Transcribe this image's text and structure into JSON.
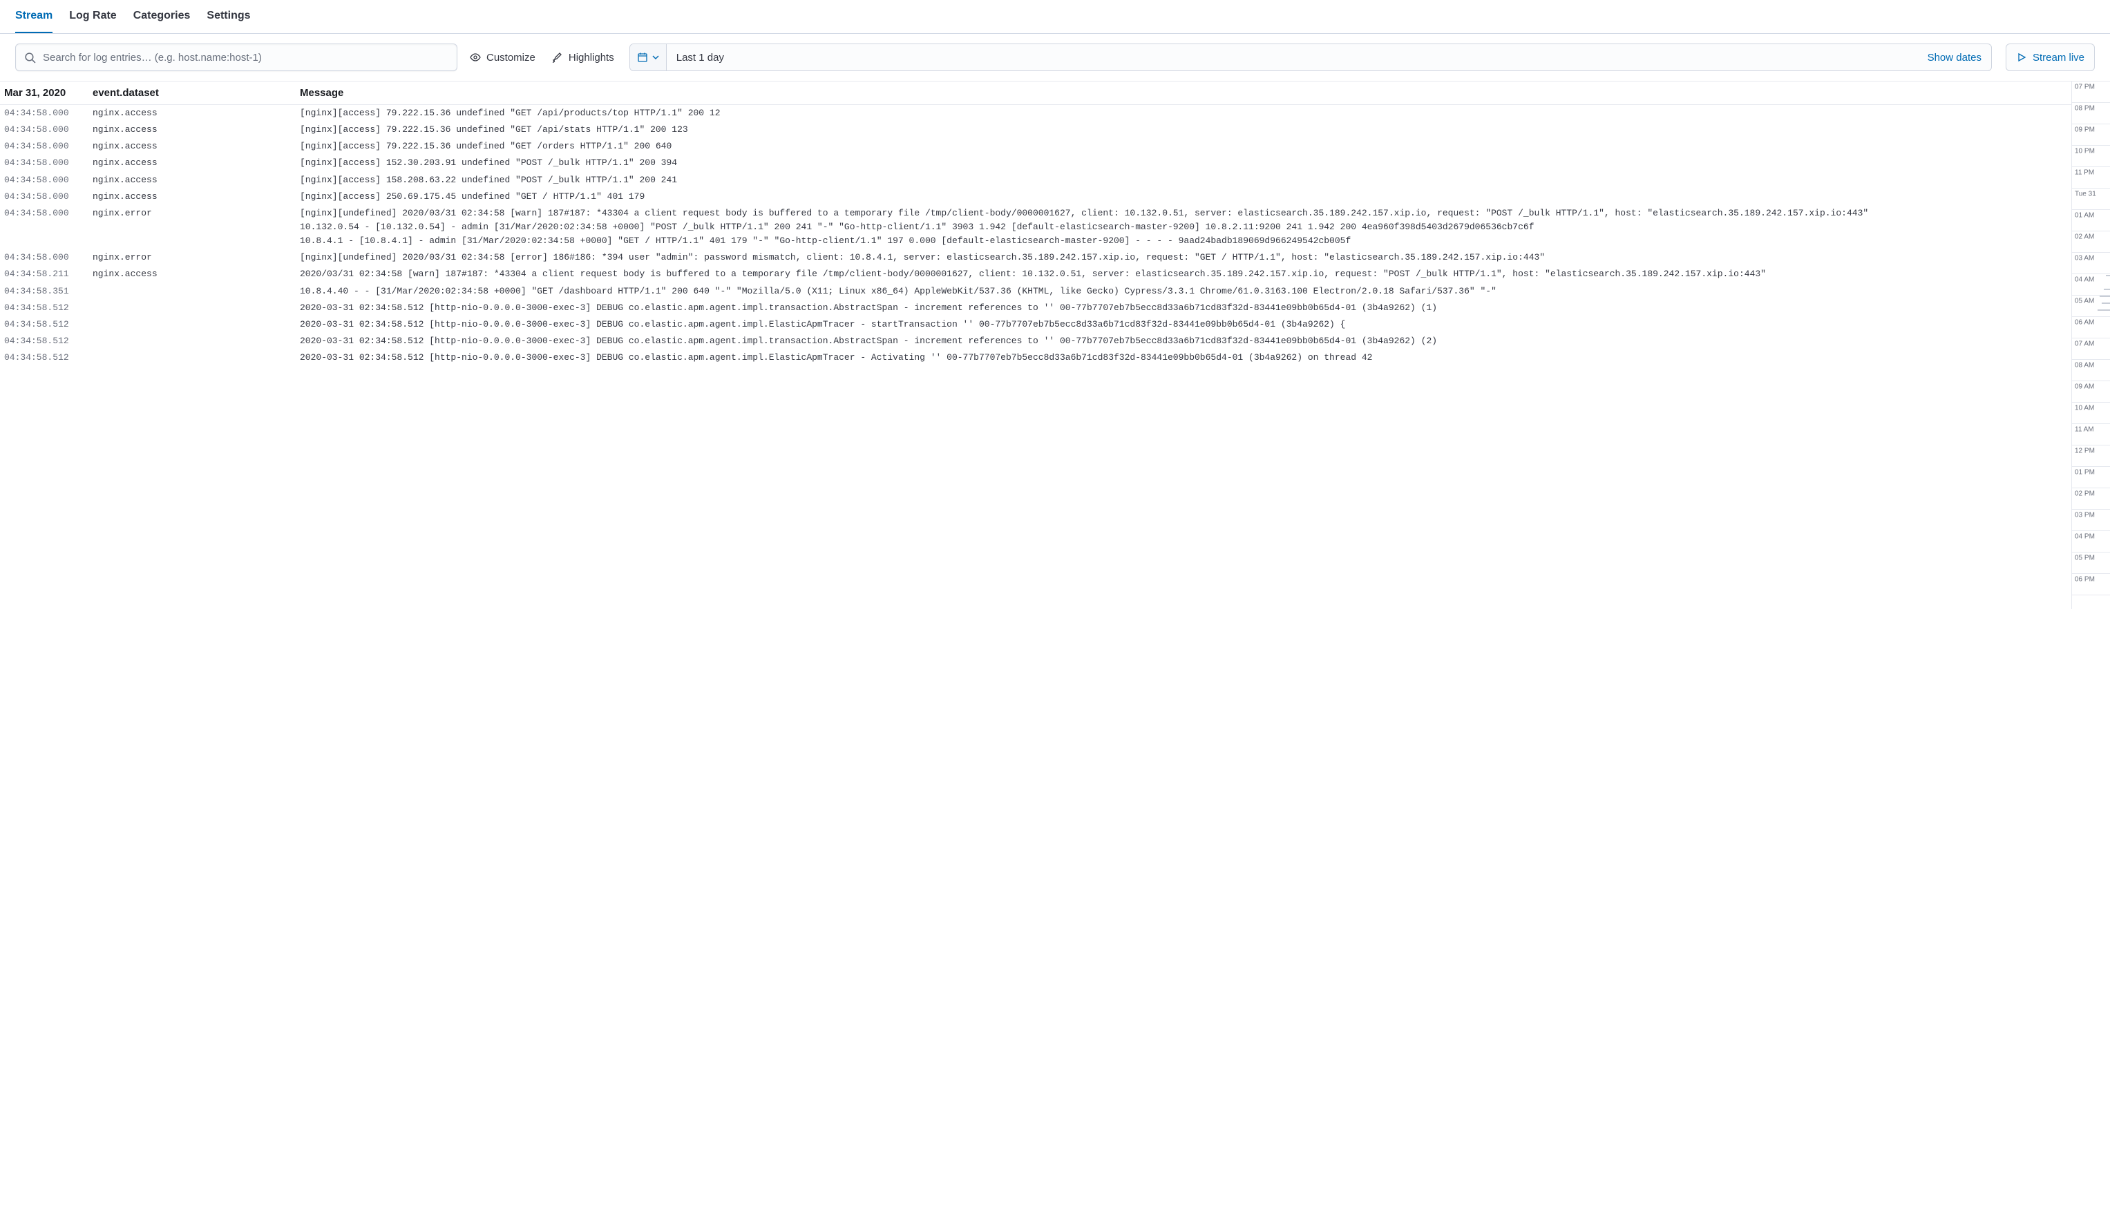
{
  "tabs": [
    {
      "label": "Stream",
      "active": true
    },
    {
      "label": "Log Rate",
      "active": false
    },
    {
      "label": "Categories",
      "active": false
    },
    {
      "label": "Settings",
      "active": false
    }
  ],
  "toolbar": {
    "search_placeholder": "Search for log entries… (e.g. host.name:host-1)",
    "customize_label": "Customize",
    "highlights_label": "Highlights",
    "date_range_text": "Last 1 day",
    "show_dates_label": "Show dates",
    "stream_live_label": "Stream live"
  },
  "columns": {
    "time_header": "Mar 31, 2020",
    "dataset_header": "event.dataset",
    "message_header": "Message"
  },
  "log_rows": [
    {
      "time": "04:34:58.000",
      "dataset": "nginx.access",
      "message": "[nginx][access] 79.222.15.36 undefined \"GET /api/products/top HTTP/1.1\" 200 12"
    },
    {
      "time": "04:34:58.000",
      "dataset": "nginx.access",
      "message": "[nginx][access] 79.222.15.36 undefined \"GET /api/stats HTTP/1.1\" 200 123"
    },
    {
      "time": "04:34:58.000",
      "dataset": "nginx.access",
      "message": "[nginx][access] 79.222.15.36 undefined \"GET /orders HTTP/1.1\" 200 640"
    },
    {
      "time": "04:34:58.000",
      "dataset": "nginx.access",
      "message": "[nginx][access] 152.30.203.91 undefined \"POST /_bulk HTTP/1.1\" 200 394"
    },
    {
      "time": "04:34:58.000",
      "dataset": "nginx.access",
      "message": "[nginx][access] 158.208.63.22 undefined \"POST /_bulk HTTP/1.1\" 200 241"
    },
    {
      "time": "04:34:58.000",
      "dataset": "nginx.access",
      "message": "[nginx][access] 250.69.175.45 undefined \"GET / HTTP/1.1\" 401 179"
    },
    {
      "time": "04:34:58.000",
      "dataset": "nginx.error",
      "message": "[nginx][undefined] 2020/03/31 02:34:58 [warn] 187#187: *43304 a client request body is buffered to a temporary file /tmp/client-body/0000001627, client: 10.132.0.51, server: elasticsearch.35.189.242.157.xip.io, request: \"POST /_bulk HTTP/1.1\", host: \"elasticsearch.35.189.242.157.xip.io:443\"\n10.132.0.54 - [10.132.0.54] - admin [31/Mar/2020:02:34:58 +0000] \"POST /_bulk HTTP/1.1\" 200 241 \"-\" \"Go-http-client/1.1\" 3903 1.942 [default-elasticsearch-master-9200] 10.8.2.11:9200 241 1.942 200 4ea960f398d5403d2679d06536cb7c6f\n10.8.4.1 - [10.8.4.1] - admin [31/Mar/2020:02:34:58 +0000] \"GET / HTTP/1.1\" 401 179 \"-\" \"Go-http-client/1.1\" 197 0.000 [default-elasticsearch-master-9200] - - - - 9aad24badb189069d966249542cb005f"
    },
    {
      "time": "04:34:58.000",
      "dataset": "nginx.error",
      "message": "[nginx][undefined] 2020/03/31 02:34:58 [error] 186#186: *394 user \"admin\": password mismatch, client: 10.8.4.1, server: elasticsearch.35.189.242.157.xip.io, request: \"GET / HTTP/1.1\", host: \"elasticsearch.35.189.242.157.xip.io:443\""
    },
    {
      "time": "04:34:58.211",
      "dataset": "nginx.access",
      "message": "2020/03/31 02:34:58 [warn] 187#187: *43304 a client request body is buffered to a temporary file /tmp/client-body/0000001627, client: 10.132.0.51, server: elasticsearch.35.189.242.157.xip.io, request: \"POST /_bulk HTTP/1.1\", host: \"elasticsearch.35.189.242.157.xip.io:443\""
    },
    {
      "time": "04:34:58.351",
      "dataset": "",
      "message": "10.8.4.40 - - [31/Mar/2020:02:34:58 +0000] \"GET /dashboard HTTP/1.1\" 200 640 \"-\" \"Mozilla/5.0 (X11; Linux x86_64) AppleWebKit/537.36 (KHTML, like Gecko) Cypress/3.3.1 Chrome/61.0.3163.100 Electron/2.0.18 Safari/537.36\" \"-\""
    },
    {
      "time": "04:34:58.512",
      "dataset": "",
      "message": "2020-03-31 02:34:58.512 [http-nio-0.0.0.0-3000-exec-3] DEBUG co.elastic.apm.agent.impl.transaction.AbstractSpan - increment references to '' 00-77b7707eb7b5ecc8d33a6b71cd83f32d-83441e09bb0b65d4-01 (3b4a9262) (1)"
    },
    {
      "time": "04:34:58.512",
      "dataset": "",
      "message": "2020-03-31 02:34:58.512 [http-nio-0.0.0.0-3000-exec-3] DEBUG co.elastic.apm.agent.impl.ElasticApmTracer - startTransaction '' 00-77b7707eb7b5ecc8d33a6b71cd83f32d-83441e09bb0b65d4-01 (3b4a9262) {"
    },
    {
      "time": "04:34:58.512",
      "dataset": "",
      "message": "2020-03-31 02:34:58.512 [http-nio-0.0.0.0-3000-exec-3] DEBUG co.elastic.apm.agent.impl.transaction.AbstractSpan - increment references to '' 00-77b7707eb7b5ecc8d33a6b71cd83f32d-83441e09bb0b65d4-01 (3b4a9262) (2)"
    },
    {
      "time": "04:34:58.512",
      "dataset": "",
      "message": "2020-03-31 02:34:58.512 [http-nio-0.0.0.0-3000-exec-3] DEBUG co.elastic.apm.agent.impl.ElasticApmTracer - Activating '' 00-77b7707eb7b5ecc8d33a6b71cd83f32d-83441e09bb0b65d4-01 (3b4a9262) on thread 42"
    }
  ],
  "minimap": {
    "labels": [
      "07 PM",
      "08 PM",
      "09 PM",
      "10 PM",
      "11 PM",
      "Tue 31",
      "01 AM",
      "02 AM",
      "03 AM",
      "04 AM",
      "05 AM",
      "06 AM",
      "07 AM",
      "08 AM",
      "09 AM",
      "10 AM",
      "11 AM",
      "12 PM",
      "01 PM",
      "02 PM",
      "03 PM",
      "04 PM",
      "05 PM",
      "06 PM"
    ]
  }
}
